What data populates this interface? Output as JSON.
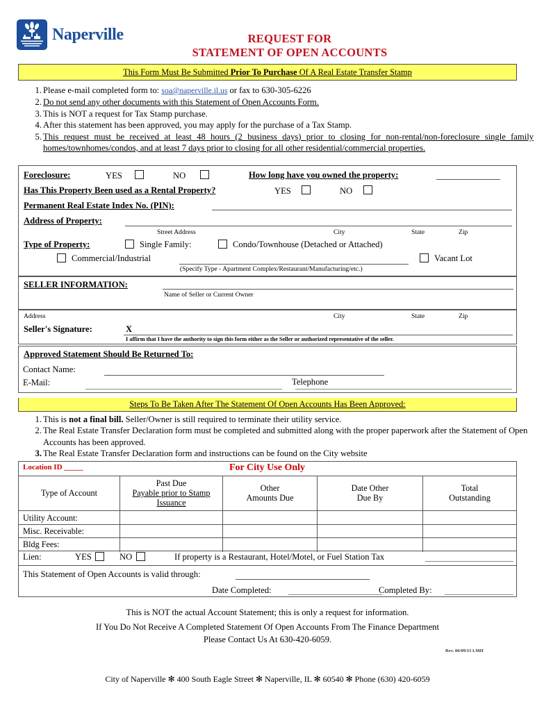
{
  "header": {
    "logo_text": "Naperville",
    "logo_color": "#1d4f9c",
    "title_line1": "REQUEST FOR",
    "title_line2": "STATEMENT OF OPEN ACCOUNTS",
    "title_color": "#c1121f"
  },
  "banner_top": {
    "text_before": "This Form Must Be Submitted ",
    "text_bold": "Prior To Purchase",
    "text_after": " Of A Real Estate Transfer Stamp",
    "background": "#ffff66"
  },
  "instructions": [
    {
      "num": "1.",
      "pre": "Please e-mail completed form to: ",
      "email": "soa@naperville.il.us",
      "post": " or fax to 630-305-6226"
    },
    {
      "num": "2.",
      "text": "Do not send any other documents with this Statement of Open Accounts Form."
    },
    {
      "num": "3.",
      "text": "This is NOT a request for Tax Stamp purchase."
    },
    {
      "num": "4.",
      "text": "After this statement has been approved, you may apply for the purchase of a Tax Stamp."
    },
    {
      "num": "5.",
      "text": "This request must be received at least 48 hours (2 business days) prior to closing for non-rental/non-foreclosure single family homes/townhomes/condos, and at least 7 days prior to closing for all other residential/commercial properties."
    }
  ],
  "form": {
    "foreclosure_label": "Foreclosure:",
    "yes_label": "YES",
    "no_label": "NO",
    "how_long_label": "How long have you owned the property:",
    "rental_label": "Has This Property Been used as a Rental Property?",
    "rental_yes": "YES",
    "rental_no": "NO",
    "pin_label": "Permanent Real Estate Index No. (PIN):",
    "address_label": "Address of Property:",
    "street_caption": "Street Address",
    "city_caption": "City",
    "state_caption": "State",
    "zip_caption": "Zip",
    "type_label": "Type of Property:",
    "type_single": "Single Family:",
    "type_condo": "Condo/Townhouse (Detached or Attached)",
    "type_commercial": "Commercial/Industrial",
    "type_vacant": "Vacant Lot",
    "specify_caption": "(Specify Type - Apartment Complex/Restaurant/Manufacturing/etc.)",
    "seller_info_label": "SELLER INFORMATION:",
    "seller_name_caption": "Name of Seller or Current Owner",
    "seller_address_caption": "Address",
    "seller_city_caption": "City",
    "seller_state_caption": "State",
    "seller_zip_caption": "Zip",
    "signature_label": "Seller's Signature:",
    "signature_x": "X",
    "affirm_caption": "I affirm that I have the authority to sign this form either as the Seller or authorized representative of the seller.",
    "returned_to_label": "Approved Statement Should Be Returned To:",
    "contact_name_label": "Contact Name:",
    "email_label": "E-Mail:",
    "telephone_label": "Telephone"
  },
  "banner_steps": {
    "text": "Steps To Be Taken After The Statement Of Open Accounts Has Been Approved:",
    "background": "#ffff66"
  },
  "steps": [
    {
      "num": "1.",
      "pre": "This is ",
      "bold": "not a final bill.",
      "post": "  Seller/Owner is still required to terminate their utility service."
    },
    {
      "num": "2.",
      "text": "The Real Estate Transfer Declaration form must be completed and submitted along with the proper paperwork after the Statement of Open Accounts has been approved."
    },
    {
      "num": "3.",
      "text": "The Real Estate Transfer Declaration form and instructions can be found on the City website",
      "bold_num": true
    }
  ],
  "city_use": {
    "location_id_label": "Location ID _____",
    "title": "For City Use Only",
    "title_color": "#cc0000",
    "columns": [
      {
        "line1": "Type of Account",
        "line2": "",
        "line3": ""
      },
      {
        "line1": "Past Due",
        "line2": "Payable prior to Stamp",
        "line3": "Issuance"
      },
      {
        "line1": "Other",
        "line2": "Amounts Due",
        "line3": ""
      },
      {
        "line1": "Date Other",
        "line2": "Due By",
        "line3": ""
      },
      {
        "line1": "Total",
        "line2": "Outstanding",
        "line3": ""
      }
    ],
    "rows": [
      {
        "label": "Utility Account:",
        "c1": "",
        "c2": "",
        "c3": "",
        "c4": ""
      },
      {
        "label": "Misc. Receivable:",
        "c1": "",
        "c2": "",
        "c3": "",
        "c4": ""
      },
      {
        "label": "Bldg Fees:",
        "c1": "",
        "c2": "",
        "c3": "",
        "c4": ""
      }
    ],
    "lien_label": "Lien:",
    "lien_yes": "YES",
    "lien_no": "NO",
    "lien_note": "If property is a Restaurant, Hotel/Motel, or Fuel Station Tax",
    "valid_through_label": "This Statement of Open Accounts is valid through:",
    "date_completed_label": "Date Completed:",
    "completed_by_label": "Completed By:"
  },
  "footer": {
    "line1": "This is NOT the actual Account Statement; this is only a request for information.",
    "line2": "If You Do Not Receive A Completed Statement Of Open Accounts From The Finance Department",
    "line3": "Please Contact Us At 630-420-6059.",
    "revision": "Rev. 06/09/15 LMH",
    "address_line": "City of Naperville ✻ 400 South Eagle Street ✻ Naperville, IL ✻ 60540 ✻ Phone (630) 420-6059"
  }
}
